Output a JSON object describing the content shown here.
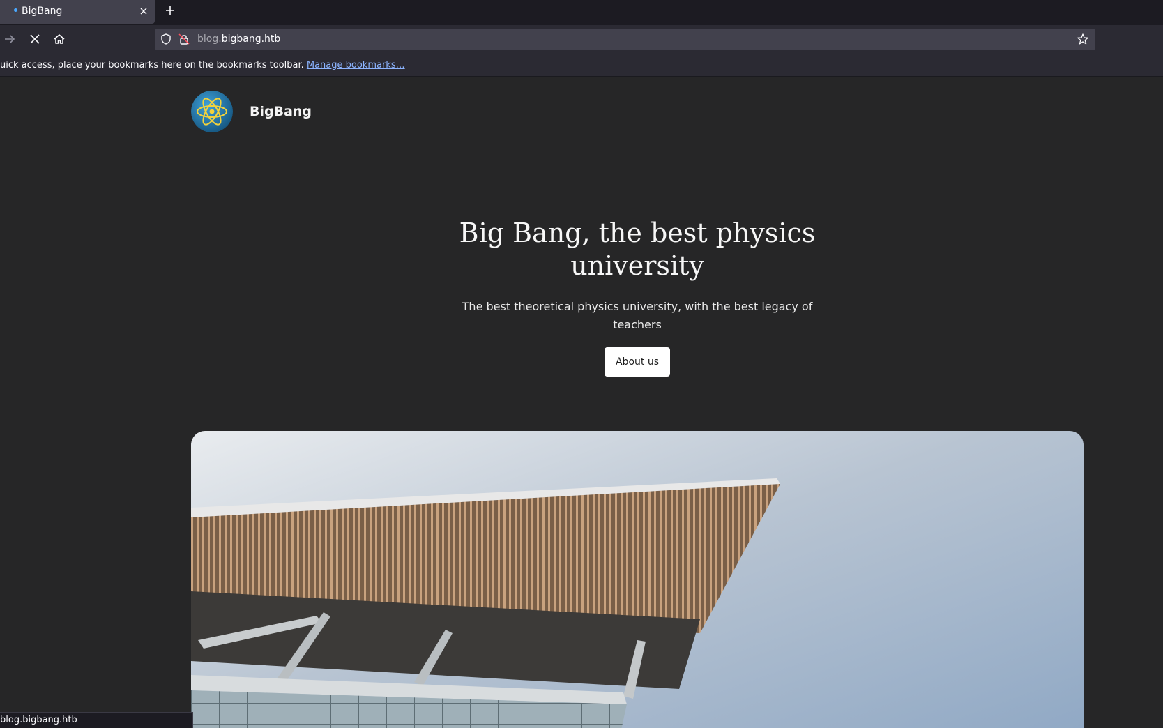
{
  "browser": {
    "tab": {
      "title": "BigBang"
    },
    "url": {
      "subdomain": "blog.",
      "domain": "bigbang.htb"
    },
    "bookmarks_bar": {
      "message": "uick access, place your bookmarks here on the bookmarks toolbar.",
      "link": "Manage bookmarks…"
    },
    "status": "blog.bigbang.htb"
  },
  "site": {
    "name": "BigBang",
    "hero": {
      "title": "Big Bang, the best physics university",
      "subtitle": "The best theoretical physics university, with the best legacy of teachers",
      "button": "About us"
    }
  },
  "icons": {
    "tab_close": "close-icon",
    "new_tab": "plus-icon",
    "forward": "arrow-right-icon",
    "stop": "stop-icon",
    "home": "home-icon",
    "shield": "shield-icon",
    "lock": "insecure-lock-icon",
    "bookmark": "star-icon",
    "logo": "atom-logo-icon"
  }
}
